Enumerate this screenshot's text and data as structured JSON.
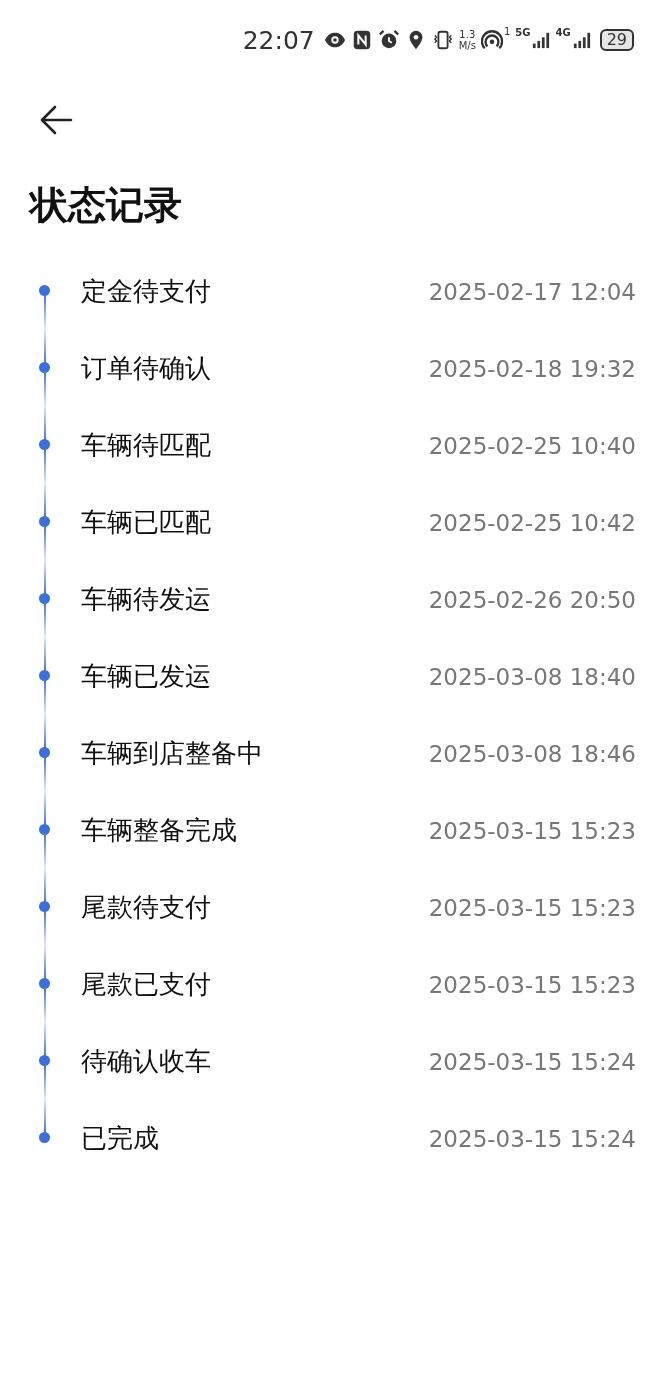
{
  "status_bar": {
    "time": "22:07",
    "speed_value": "1.3",
    "speed_unit": "M/s",
    "hotspot_count": "1",
    "network_1": "5G",
    "network_2": "4G",
    "battery": "29"
  },
  "title": "状态记录",
  "records": [
    {
      "status": "定金待支付",
      "time": "2025-02-17 12:04"
    },
    {
      "status": "订单待确认",
      "time": "2025-02-18 19:32"
    },
    {
      "status": "车辆待匹配",
      "time": "2025-02-25 10:40"
    },
    {
      "status": "车辆已匹配",
      "time": "2025-02-25 10:42"
    },
    {
      "status": "车辆待发运",
      "time": "2025-02-26 20:50"
    },
    {
      "status": "车辆已发运",
      "time": "2025-03-08 18:40"
    },
    {
      "status": "车辆到店整备中",
      "time": "2025-03-08 18:46"
    },
    {
      "status": "车辆整备完成",
      "time": "2025-03-15 15:23"
    },
    {
      "status": "尾款待支付",
      "time": "2025-03-15 15:23"
    },
    {
      "status": "尾款已支付",
      "time": "2025-03-15 15:23"
    },
    {
      "status": "待确认收车",
      "time": "2025-03-15 15:24"
    },
    {
      "status": "已完成",
      "time": "2025-03-15 15:24"
    }
  ]
}
